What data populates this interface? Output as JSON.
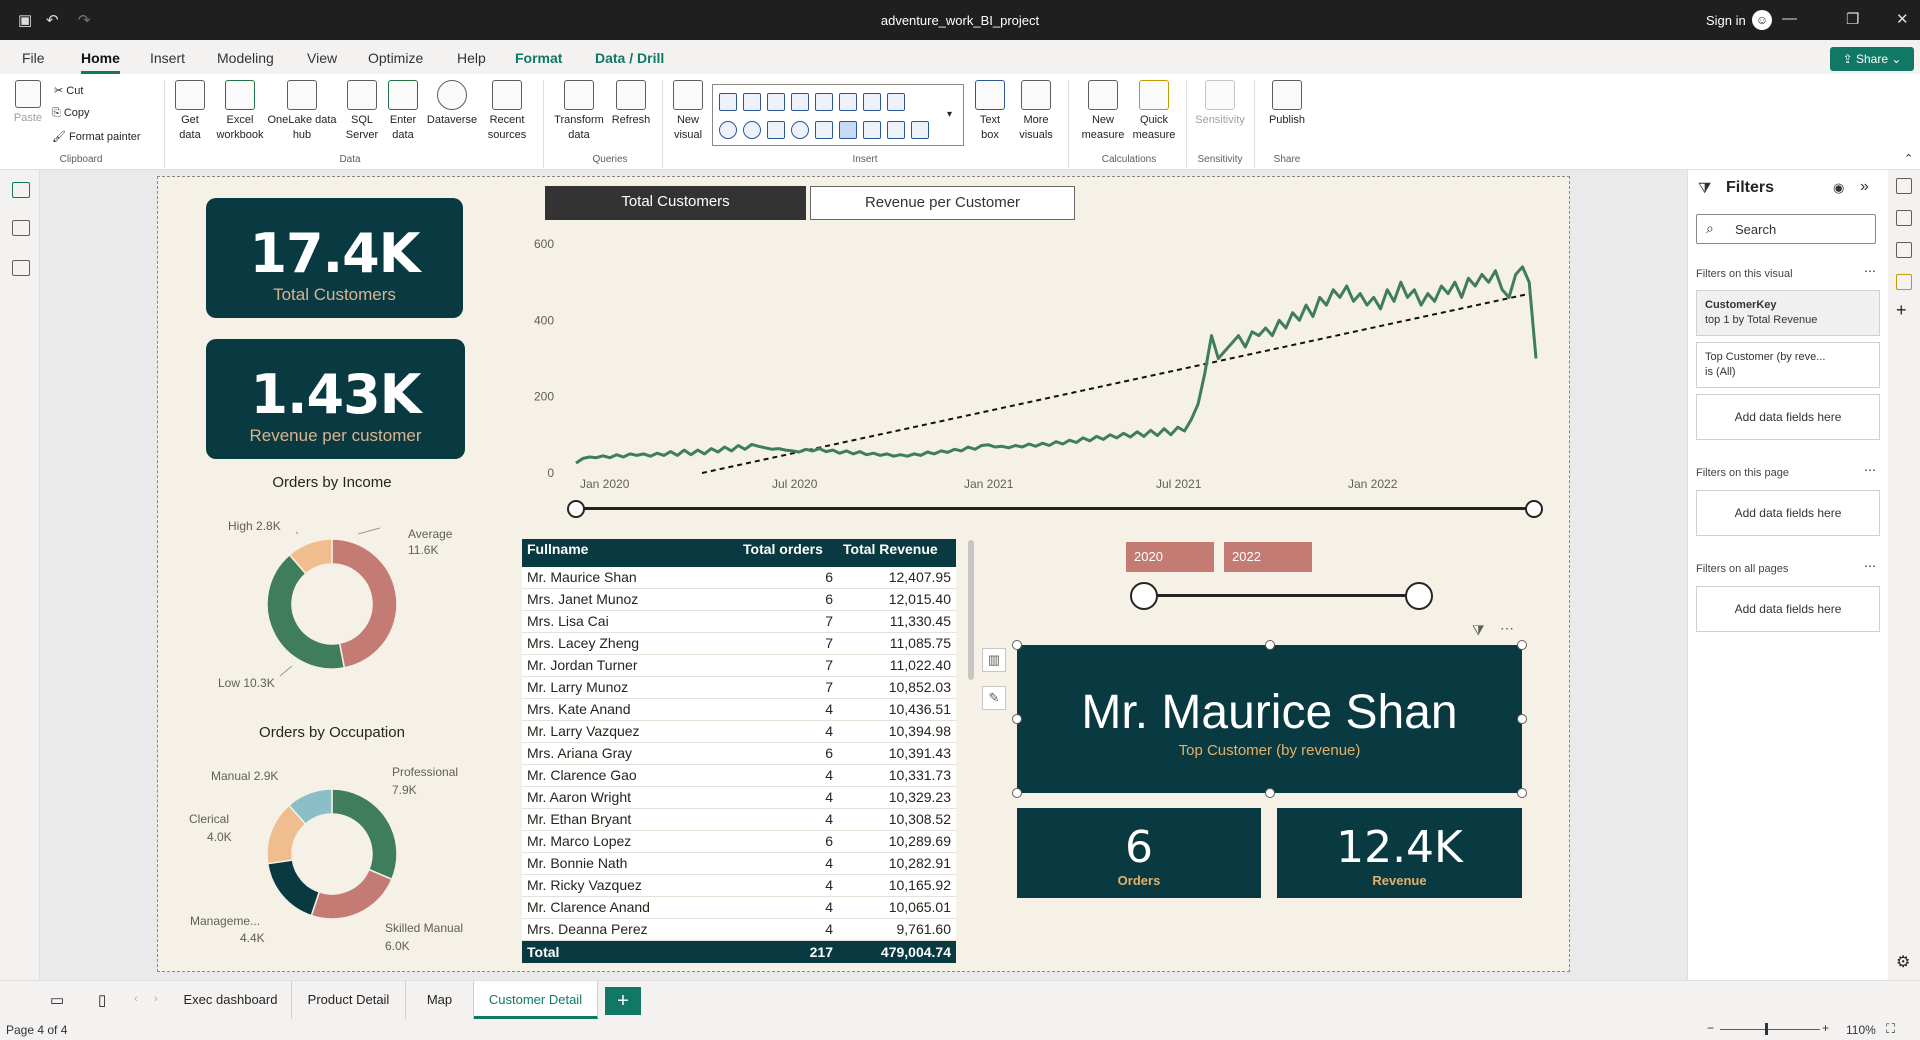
{
  "window": {
    "title": "adventure_work_BI_project",
    "sign_in": "Sign in"
  },
  "menu": [
    "File",
    "Home",
    "Insert",
    "Modeling",
    "View",
    "Optimize",
    "Help",
    "Format",
    "Data / Drill"
  ],
  "share_label": "Share",
  "ribbon": {
    "clipboard": {
      "paste": "Paste",
      "cut": "Cut",
      "copy": "Copy",
      "format_painter": "Format painter",
      "group": "Clipboard"
    },
    "data": {
      "get_data": "Get data",
      "excel": "Excel workbook",
      "onelake": "OneLake data hub",
      "sql": "SQL Server",
      "enter": "Enter data",
      "dataverse": "Dataverse",
      "recent": "Recent sources",
      "group": "Data"
    },
    "queries": {
      "transform": "Transform data",
      "refresh": "Refresh",
      "group": "Queries"
    },
    "insert": {
      "new_visual": "New visual",
      "text_box": "Text box",
      "more_visuals": "More visuals",
      "group": "Insert"
    },
    "calc": {
      "new_measure": "New measure",
      "quick_measure": "Quick measure",
      "group": "Calculations"
    },
    "sensitivity": {
      "label": "Sensitivity",
      "group": "Sensitivity"
    },
    "share": {
      "publish": "Publish",
      "group": "Share"
    }
  },
  "kpis": {
    "customers": {
      "value": "17.4K",
      "label": "Total Customers"
    },
    "rev_per_customer": {
      "value": "1.43K",
      "label": "Revenue per customer"
    }
  },
  "donut_income": {
    "title": "Orders by Income",
    "labels": {
      "high": "High 2.8K",
      "average": "Average",
      "average_v": "11.6K",
      "low": "Low 10.3K"
    }
  },
  "donut_occupation": {
    "title": "Orders by Occupation",
    "labels": {
      "manual": "Manual 2.9K",
      "professional": "Professional",
      "professional_v": "7.9K",
      "clerical": "Clerical",
      "clerical_v": "4.0K",
      "management": "Manageme...",
      "management_v": "4.4K",
      "skilled": "Skilled Manual",
      "skilled_v": "6.0K"
    }
  },
  "line_tabs": {
    "active": "Total Customers",
    "inactive": "Revenue per Customer"
  },
  "chart_data": {
    "type": "line",
    "title": "",
    "x_ticks": [
      "Jan 2020",
      "Jul 2020",
      "Jan 2021",
      "Jul 2021",
      "Jan 2022"
    ],
    "y_ticks": [
      "0",
      "200",
      "400",
      "600"
    ],
    "ylim": [
      0,
      600
    ],
    "xlabel": "",
    "ylabel": "",
    "series": [
      {
        "values": [
          26,
          38,
          42,
          40,
          45,
          40,
          48,
          42,
          50,
          46,
          50,
          44,
          52,
          46,
          56,
          46,
          60,
          48,
          60,
          50,
          64,
          55,
          68,
          58,
          72,
          62,
          75,
          70,
          66,
          62,
          64,
          60,
          58,
          55,
          62,
          58,
          64,
          56,
          60,
          52,
          58,
          50,
          56,
          48,
          52,
          46,
          50,
          44,
          48,
          44,
          50,
          46,
          55,
          50,
          58,
          54,
          62,
          58,
          68,
          62,
          72,
          74,
          68,
          70,
          66,
          72,
          68,
          76,
          70,
          78,
          72,
          82,
          76,
          86,
          80,
          92,
          84,
          96,
          88,
          100,
          92,
          104,
          94,
          108,
          96,
          112,
          98,
          116,
          100,
          120,
          110,
          140,
          180,
          260,
          360,
          300,
          320,
          340,
          360,
          330,
          370,
          360,
          380,
          360,
          400,
          380,
          420,
          400,
          440,
          410,
          460,
          440,
          480,
          460,
          490,
          450,
          470,
          440,
          460,
          430,
          480,
          450,
          500,
          460,
          480,
          440,
          470,
          450,
          490,
          470,
          500,
          460,
          510,
          490,
          520,
          500,
          530,
          480,
          460,
          520,
          540,
          500,
          300
        ]
      },
      {
        "values": [
          0,
          470
        ]
      }
    ],
    "legend": "none",
    "grid": false
  },
  "table": {
    "headers": [
      "Fullname",
      "Total orders",
      "Total Revenue"
    ],
    "rows": [
      [
        "Mr. Maurice Shan",
        "6",
        "12,407.95"
      ],
      [
        "Mrs. Janet Munoz",
        "6",
        "12,015.40"
      ],
      [
        "Mrs. Lisa Cai",
        "7",
        "11,330.45"
      ],
      [
        "Mrs. Lacey Zheng",
        "7",
        "11,085.75"
      ],
      [
        "Mr. Jordan Turner",
        "7",
        "11,022.40"
      ],
      [
        "Mr. Larry Munoz",
        "7",
        "10,852.03"
      ],
      [
        "Mrs. Kate Anand",
        "4",
        "10,436.51"
      ],
      [
        "Mr. Larry Vazquez",
        "4",
        "10,394.98"
      ],
      [
        "Mrs. Ariana Gray",
        "6",
        "10,391.43"
      ],
      [
        "Mr. Clarence Gao",
        "4",
        "10,331.73"
      ],
      [
        "Mr. Aaron Wright",
        "4",
        "10,329.23"
      ],
      [
        "Mr. Ethan Bryant",
        "4",
        "10,308.52"
      ],
      [
        "Mr. Marco Lopez",
        "6",
        "10,289.69"
      ],
      [
        "Mr. Bonnie Nath",
        "4",
        "10,282.91"
      ],
      [
        "Mr. Ricky Vazquez",
        "4",
        "10,165.92"
      ],
      [
        "Mr. Clarence Anand",
        "4",
        "10,065.01"
      ],
      [
        "Mrs. Deanna Perez",
        "4",
        "9,761.60"
      ]
    ],
    "total": [
      "Total",
      "217",
      "479,004.74"
    ]
  },
  "year_slicer": {
    "from": "2020",
    "to": "2022"
  },
  "top_customer": {
    "name": "Mr. Maurice Shan",
    "label": "Top Customer (by revenue)"
  },
  "mini_cards": {
    "orders": {
      "value": "6",
      "label": "Orders"
    },
    "revenue": {
      "value": "12.4K",
      "label": "Revenue"
    }
  },
  "filters": {
    "title": "Filters",
    "search": "Search",
    "on_visual": "Filters on this visual",
    "card1_title": "CustomerKey",
    "card1_sub": "top 1 by Total Revenue",
    "card2_title": "Top Customer (by reve...",
    "card2_sub": "is (All)",
    "add": "Add data fields here",
    "on_page": "Filters on this page",
    "on_all": "Filters on all pages"
  },
  "pages": [
    "Exec dashboard",
    "Product Detail",
    "Map",
    "Customer Detail"
  ],
  "status": {
    "page": "Page 4 of 4",
    "zoom": "110%"
  },
  "colors": {
    "dark_teal": "#093a41",
    "green": "#3f7d5c",
    "salmon": "#c47b74",
    "peach": "#f0bd8f",
    "light_blue": "#8bbec6",
    "accent": "#117865"
  }
}
